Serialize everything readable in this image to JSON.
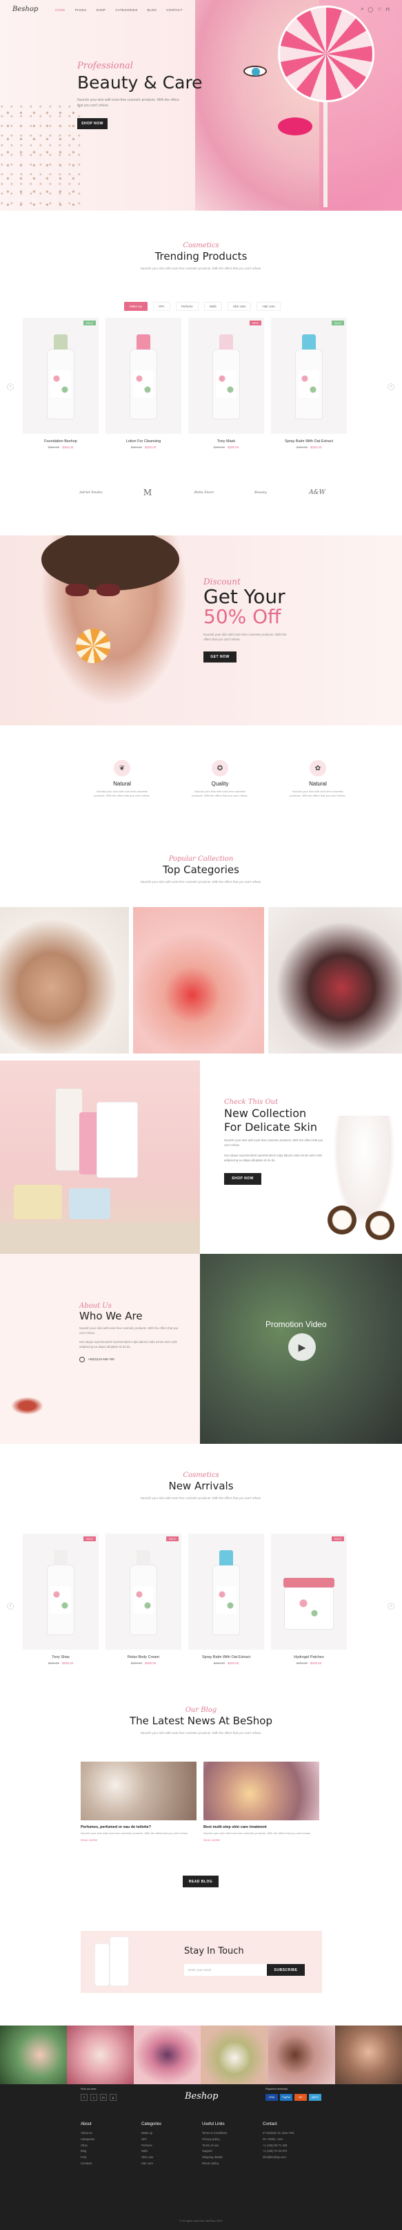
{
  "nav": {
    "logo": "Beshop",
    "links": [
      "HOME",
      "PAGES",
      "SHOP",
      "CATEGORIES",
      "BLOG",
      "CONTACT"
    ],
    "active_index": 0,
    "icons": [
      "search-icon",
      "user-icon",
      "heart-icon",
      "cart-icon"
    ]
  },
  "hero": {
    "script": "Professional",
    "title": "Beauty & Care",
    "subtitle": "Nourish your skin with toxin-free cosmetic products. With the offers that you can't refuse.",
    "button": "SHOP NOW"
  },
  "trending": {
    "script": "Cosmetics",
    "title": "Trending Products",
    "subtitle": "Nourish your skin with toxin-free cosmetic products. With the offers that you can't refuse.",
    "tabs": [
      "Make Up",
      "SPA",
      "Perfume",
      "Nails",
      "Skin care",
      "Hair care"
    ],
    "active_tab": 0,
    "products": [
      {
        "name": "Foundation Beshop",
        "old": "$300.00",
        "price": "$200.00",
        "badge": "SALE",
        "badge_color": "#7fc28d",
        "cap": "#c8d7b8",
        "kind": "bottle"
      },
      {
        "name": "Lotion For Cleansing",
        "old": "$300.00",
        "price": "$200.00",
        "badge": "",
        "badge_color": "",
        "cap": "#f08fa8",
        "kind": "bottle"
      },
      {
        "name": "Tony Mask",
        "old": "$300.00",
        "price": "$200.00",
        "badge": "NEW",
        "badge_color": "#e56b88",
        "cap": "#f4d2dc",
        "kind": "bottle"
      },
      {
        "name": "Spray Balm With Oat Extract",
        "old": "$300.00",
        "price": "$200.00",
        "badge": "SALE",
        "badge_color": "#7fc28d",
        "cap": "#6cc7e0",
        "kind": "bottle"
      }
    ]
  },
  "brands": [
    "Adriel Studio",
    "M",
    "Bella Store",
    "Beauty",
    "A&W"
  ],
  "promo": {
    "script": "Discount",
    "line1": "Get Your",
    "line2": "50% Off",
    "subtitle": "Nourish your skin with toxin-free cosmetic products. With the offers that you can't refuse.",
    "button": "GET NOW"
  },
  "features": [
    {
      "icon": "leaf-icon",
      "title": "Natural",
      "text": "Nourish your skin with toxin-free cosmetic products. With the offers that you can't refuse."
    },
    {
      "icon": "badge-icon",
      "title": "Quality",
      "text": "Nourish your skin with toxin-free cosmetic products. With the offers that you can't refuse."
    },
    {
      "icon": "flower-icon",
      "title": "Natural",
      "text": "Nourish your skin with toxin-free cosmetic products. With the offers that you can't refuse."
    }
  ],
  "categories": {
    "script": "Popular Collection",
    "title": "Top Categories",
    "subtitle": "Nourish your skin with toxin-free cosmetic products. With the offers that you can't refuse."
  },
  "collection": {
    "script": "Check This Out",
    "title_line1": "New Collection",
    "title_line2": "For Delicate Skin",
    "text1": "Nourish your skin with toxin-free cosmetic products. With the offers that you can't refuse.",
    "text2": "Non aliqua reprehenderit reprehenderit culpa laboris nulla minim anim velit adipisicing ea aliqua alluptate sit do do.",
    "button": "SHOP NOW"
  },
  "who": {
    "script": "About Us",
    "title": "Who We Are",
    "text1": "Nourish your skin with toxin-free cosmetic products. With the offers that you can't refuse.",
    "text2": "Non aliqua reprehenderit reprehenderit culpa laboris nulla minim anim velit adipisicing ea aliqua alluptate sit do do.",
    "contact": "+38(0)123-456-789",
    "video_label": "Promotion Video"
  },
  "arrivals": {
    "script": "Cosmetics",
    "title": "New Arrivals",
    "subtitle": "Nourish your skin with toxin-free cosmetic products. With the offers that you can't refuse.",
    "products": [
      {
        "name": "Tony Shas",
        "old": "$300.00",
        "price": "$200.00",
        "badge": "SALE",
        "badge_color": "#e56b88",
        "cap": "#f1eeee",
        "kind": "bottle"
      },
      {
        "name": "Relax Body Cream",
        "old": "$300.00",
        "price": "$200.00",
        "badge": "SALE",
        "badge_color": "#e56b88",
        "cap": "#f1eeee",
        "kind": "bottle"
      },
      {
        "name": "Spray Balm With Oat Extract",
        "old": "$300.00",
        "price": "$200.00",
        "badge": "",
        "badge_color": "",
        "cap": "#6cc7e0",
        "kind": "bottle"
      },
      {
        "name": "Hydrogel Patches",
        "old": "$300.00",
        "price": "$200.00",
        "badge": "SALE",
        "badge_color": "#e56b88",
        "cap": "#e57d8f",
        "kind": "jar"
      }
    ]
  },
  "news": {
    "script": "Our Blog",
    "title": "The Latest News At BeShop",
    "subtitle": "Nourish your skin with toxin-free cosmetic products. With the offers that you can't refuse.",
    "items": [
      {
        "title": "Perfumes, perfumed or eau de toilette?",
        "text": "Nourish your skin with toxin-free cosmetic products. With the offers that you can't refuse.",
        "more": "READ MORE"
      },
      {
        "title": "Best multi-step skin care treatment",
        "text": "Nourish your skin with toxin-free cosmetic products. With the offers that you can't refuse.",
        "more": "READ MORE"
      }
    ],
    "button": "READ BLOG"
  },
  "newsletter": {
    "title": "Stay In Touch",
    "placeholder": "Enter your email",
    "button": "SUBSCRIBE"
  },
  "footer": {
    "logo": "Beshop",
    "follow": "Find us here:",
    "socials": [
      "f",
      "t",
      "in",
      "p"
    ],
    "pay_title": "Payment methods",
    "pays": [
      {
        "label": "VISA",
        "color": "#1a4aa0"
      },
      {
        "label": "PayPal",
        "color": "#1f76c2"
      },
      {
        "label": "MC",
        "color": "#e25a1f"
      },
      {
        "label": "AMEX",
        "color": "#3aa0d8"
      }
    ],
    "cols": [
      {
        "title": "About",
        "items": [
          "About us",
          "Categories",
          "Shop",
          "Blog",
          "FAQ",
          "Contacts"
        ]
      },
      {
        "title": "Categories",
        "items": [
          "Make up",
          "SPA",
          "Perfume",
          "Nails",
          "Skin care",
          "Hair care"
        ]
      },
      {
        "title": "Useful Links",
        "items": [
          "Terms & Conditions",
          "Privacy policy",
          "Terms of use",
          "Support",
          "Shipping details",
          "Return policy"
        ]
      },
      {
        "title": "Contact",
        "items": [
          "27 Division St, New York",
          "NY 10002, USA",
          "+1 (345) 99 71 345",
          "+1 (345) 70 44 974",
          "info@beshop.com"
        ]
      }
    ],
    "copyright": "© All rights reserved. BeShop 2021"
  }
}
